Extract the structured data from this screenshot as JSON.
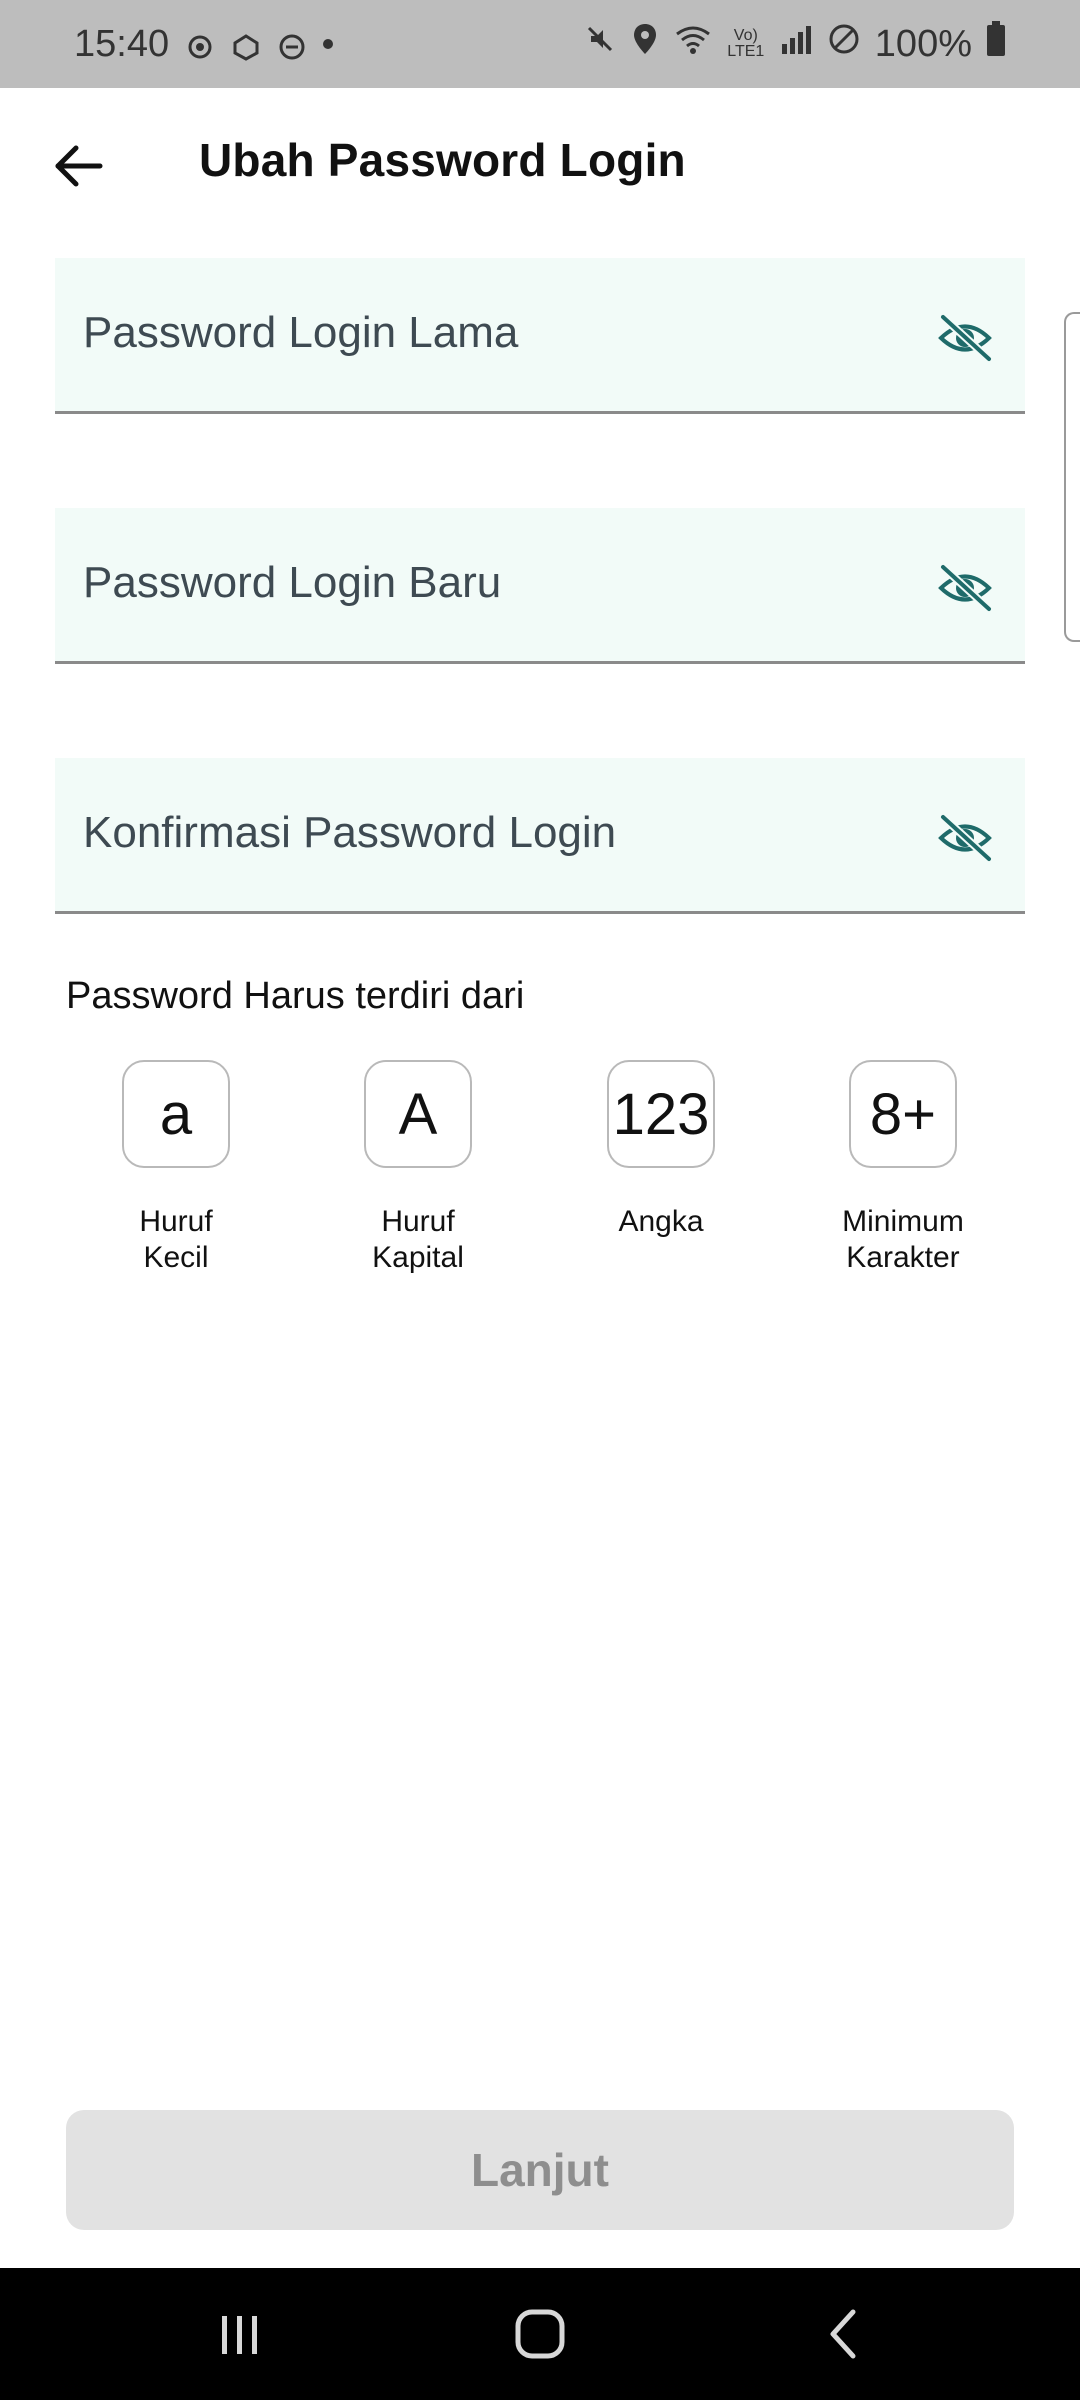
{
  "status_bar": {
    "time": "15:40",
    "left_icons": [
      "settings-gear-icon",
      "settings-alt-icon",
      "do-not-disturb-icon",
      "notification-dot-icon"
    ],
    "right_icons": [
      "mute-icon",
      "location-icon",
      "wifi-icon",
      "volte-icon",
      "signal-icon",
      "blocked-icon",
      "battery-icon"
    ],
    "volte_text": "Vo) LTE1",
    "battery": "100%"
  },
  "header": {
    "title": "Ubah Password Login"
  },
  "fields": [
    {
      "placeholder": "Password Login Lama"
    },
    {
      "placeholder": "Password Login Baru"
    },
    {
      "placeholder": "Konfirmasi Password Login"
    }
  ],
  "requirements": {
    "title": "Password Harus terdiri dari",
    "items": [
      {
        "symbol": "a",
        "label": "Huruf\nKecil"
      },
      {
        "symbol": "A",
        "label": "Huruf\nKapital"
      },
      {
        "symbol": "123",
        "label": "Angka"
      },
      {
        "symbol": "8+",
        "label": "Minimum\nKarakter"
      }
    ]
  },
  "actions": {
    "continue_label": "Lanjut"
  },
  "colors": {
    "field_bg": "#f2fbf8",
    "eye_icon": "#1f6b6a",
    "button_disabled_bg": "#e2e2e2",
    "button_disabled_text": "#8e8e8e"
  }
}
